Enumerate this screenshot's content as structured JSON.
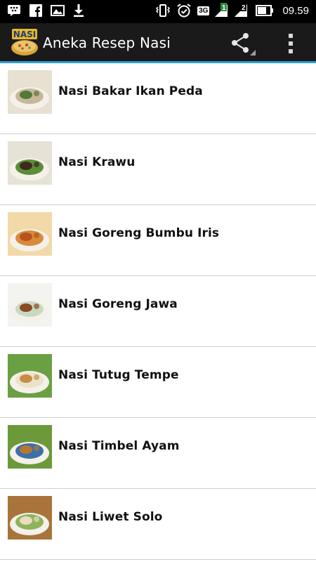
{
  "status_bar": {
    "time": "09.59",
    "network_label": "3G",
    "sim1_label": "1",
    "sim2_label": "2",
    "icons": [
      "bbm-icon",
      "facebook-icon",
      "gallery-icon",
      "download-icon",
      "vibrate-icon",
      "alarm-icon",
      "signal-icon",
      "battery-icon"
    ]
  },
  "action_bar": {
    "logo_text": "NASI",
    "title": "Aneka Resep Nasi",
    "share_icon": "share-icon",
    "overflow_icon": "overflow-menu-icon"
  },
  "recipes": [
    {
      "label": "Nasi Bakar Ikan Peda",
      "thumb_colors": [
        "#c9b79a",
        "#4f7a3a",
        "#e8e0d0"
      ]
    },
    {
      "label": "Nasi Krawu",
      "thumb_colors": [
        "#5b8d3a",
        "#3e2a1c",
        "#e7e2d6"
      ]
    },
    {
      "label": "Nasi Goreng Bumbu Iris",
      "thumb_colors": [
        "#d98b3a",
        "#b5541c",
        "#f2d9a8"
      ]
    },
    {
      "label": "Nasi Goreng Jawa",
      "thumb_colors": [
        "#c8d9c2",
        "#8a4a22",
        "#f3f3ef"
      ]
    },
    {
      "label": "Nasi Tutug Tempe",
      "thumb_colors": [
        "#e9e4c9",
        "#c98b47",
        "#6aa043"
      ]
    },
    {
      "label": "Nasi Timbel Ayam",
      "thumb_colors": [
        "#3e6fa8",
        "#b7772f",
        "#6c9a3b"
      ]
    },
    {
      "label": "Nasi Liwet Solo",
      "thumb_colors": [
        "#8fb35a",
        "#e9dcc2",
        "#a8743c"
      ]
    }
  ],
  "colors": {
    "status_bar_bg": "#000000",
    "action_bar_bg": "#1a1a1a",
    "accent": "#2a9fd6",
    "divider": "#d0d0d0"
  }
}
